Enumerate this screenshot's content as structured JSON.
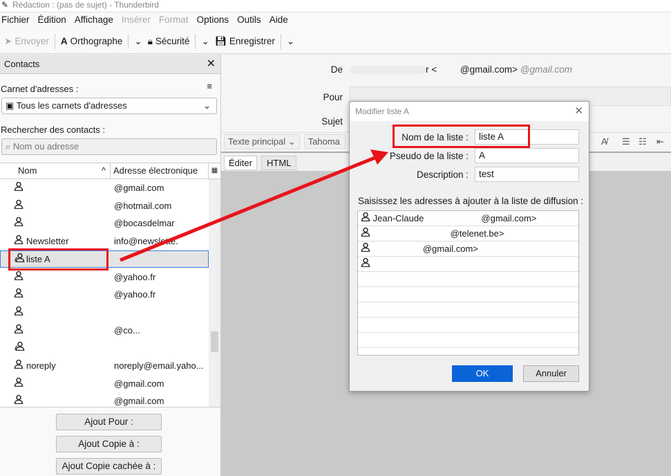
{
  "window": {
    "title": "Rédaction : (pas de sujet) - Thunderbird"
  },
  "menu": [
    {
      "label": "Fichier",
      "enabled": true
    },
    {
      "label": "Édition",
      "enabled": true
    },
    {
      "label": "Affichage",
      "enabled": true
    },
    {
      "label": "Insérer",
      "enabled": false
    },
    {
      "label": "Format",
      "enabled": false
    },
    {
      "label": "Options",
      "enabled": true
    },
    {
      "label": "Outils",
      "enabled": true
    },
    {
      "label": "Aide",
      "enabled": true
    }
  ],
  "toolbar": {
    "send": "Envoyer",
    "spelling": "Orthographe",
    "security": "Sécurité",
    "save": "Enregistrer"
  },
  "contacts": {
    "title": "Contacts",
    "addressbook_label": "Carnet d'adresses :",
    "addressbook_value": "Tous les carnets d'adresses",
    "search_label": "Rechercher des contacts :",
    "search_placeholder": "Nom ou adresse",
    "columns": {
      "name": "Nom",
      "email": "Adresse électronique"
    },
    "rows": [
      {
        "name": "",
        "email": "@gmail.com",
        "type": "contact"
      },
      {
        "name": "",
        "email": "@hotmail.com",
        "type": "contact"
      },
      {
        "name": "",
        "email": "@bocasdelmar",
        "type": "contact"
      },
      {
        "name": "Newsletter",
        "email": "info@newslette.",
        "type": "contact"
      },
      {
        "name": "liste A",
        "email": "",
        "type": "list",
        "selected": true
      },
      {
        "name": "",
        "email": "@yahoo.fr",
        "type": "contact"
      },
      {
        "name": "",
        "email": "@yahoo.fr",
        "type": "contact"
      },
      {
        "name": "",
        "email": "",
        "type": "contact"
      },
      {
        "name": "",
        "email": "@co...",
        "type": "contact"
      },
      {
        "name": "",
        "email": "",
        "type": "list"
      },
      {
        "name": "noreply",
        "email": "noreply@email.yaho...",
        "type": "contact"
      },
      {
        "name": "",
        "email": "@gmail.com",
        "type": "contact"
      },
      {
        "name": "",
        "email": "@gmail.com",
        "type": "contact"
      }
    ],
    "buttons": {
      "add_to": "Ajout Pour :",
      "add_cc": "Ajout Copie à :",
      "add_bcc": "Ajout Copie cachée à :"
    }
  },
  "compose": {
    "from_label": "De",
    "from_value": "r <         @gmail.com>",
    "from_alias": "@gmail.com",
    "to_label": "Pour",
    "subject_label": "Sujet",
    "paragraph_format": "Texte principal",
    "font": "Tahoma",
    "tabs": [
      "Éditer",
      "HTML"
    ]
  },
  "dialog": {
    "title": "Modifier liste A",
    "name_label": "Nom de la liste :",
    "name_value": "liste A",
    "nick_label": "Pseudo de la liste :",
    "nick_value": "A",
    "desc_label": "Description :",
    "desc_value": "test",
    "members_label": "Saisissez les adresses à ajouter à la liste de diffusion :",
    "members": [
      "Jean-Claude                       @gmail.com>",
      "                               @telenet.be>",
      "                    @gmail.com>",
      ""
    ],
    "ok": "OK",
    "cancel": "Annuler"
  },
  "colors": {
    "accent": "#0a64d8",
    "annotation": "#e8141a"
  }
}
